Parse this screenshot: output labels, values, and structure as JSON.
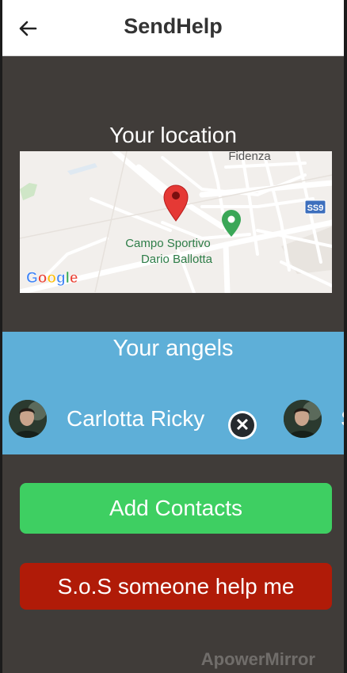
{
  "appbar": {
    "title": "SendHelp",
    "back_icon": "arrow-left-icon"
  },
  "location": {
    "title": "Your location",
    "map": {
      "town_label": "Fidenza",
      "road_badge": "SS9",
      "poi_line1": "Campo Sportivo",
      "poi_line2": "Dario Ballotta",
      "brand_letters": [
        "G",
        "o",
        "o",
        "g",
        "l",
        "e"
      ],
      "brand_colors": [
        "#4285F4",
        "#EA4335",
        "#FBBC05",
        "#4285F4",
        "#34A853",
        "#EA4335"
      ],
      "pin_color": "#e53935",
      "poi_pin_color": "#3aa757"
    }
  },
  "angels": {
    "title": "Your angels",
    "items": [
      {
        "name": "Carlotta Ricky"
      },
      {
        "name": "S"
      }
    ],
    "remove_icon": "close-icon"
  },
  "actions": {
    "add_contacts": "Add Contacts",
    "sos": "S.o.S someone help me"
  },
  "colors": {
    "background": "#403c39",
    "angels_bg": "#5eafd8",
    "add_button": "#3ecf62",
    "sos_button": "#b01b08"
  },
  "watermark": "ApowerMirror"
}
